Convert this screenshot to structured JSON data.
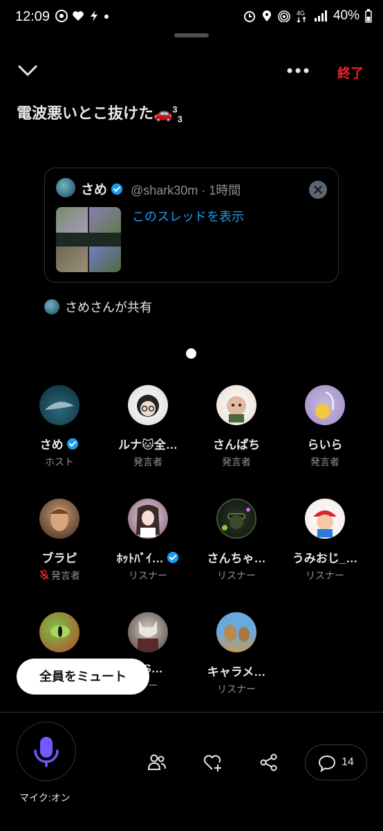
{
  "status_bar": {
    "time": "12:09",
    "battery": "40%",
    "network": "4G"
  },
  "space": {
    "title": "電波悪いとこ抜けた🚗",
    "title_sup": "3",
    "title_sub": "3",
    "end_label": "終了"
  },
  "shared_post": {
    "name": "さめ",
    "handle_time": "@shark30m · 1時間",
    "link": "このスレッドを表示",
    "shared_by": "さめさんが共有"
  },
  "participants": [
    {
      "name": "さめ",
      "role": "ホスト",
      "verified": true
    },
    {
      "name": "ルナ🐱全…",
      "role": "発言者"
    },
    {
      "name": "さんぱち",
      "role": "発言者"
    },
    {
      "name": "らいら",
      "role": "発言者"
    },
    {
      "name": "ブラピ",
      "role": "発言者",
      "muted": true
    },
    {
      "name": "ﾎｯﾄﾊﾞｲ…",
      "role": "リスナー",
      "verified": true
    },
    {
      "name": "さんちゃ…",
      "role": "リスナー"
    },
    {
      "name": "うみおじ_…",
      "role": "リスナー"
    },
    {
      "name": "",
      "role": ""
    },
    {
      "name": "/FS…",
      "role": "ナー"
    },
    {
      "name": "キャラメ…",
      "role": "リスナー"
    }
  ],
  "mute_all_label": "全員をミュート",
  "mic_label": "マイク:オン",
  "comment_count": "14",
  "colors": {
    "accent": "#1d9bf0",
    "end_red": "#f4212e",
    "mic_purple": "#7856ff"
  }
}
